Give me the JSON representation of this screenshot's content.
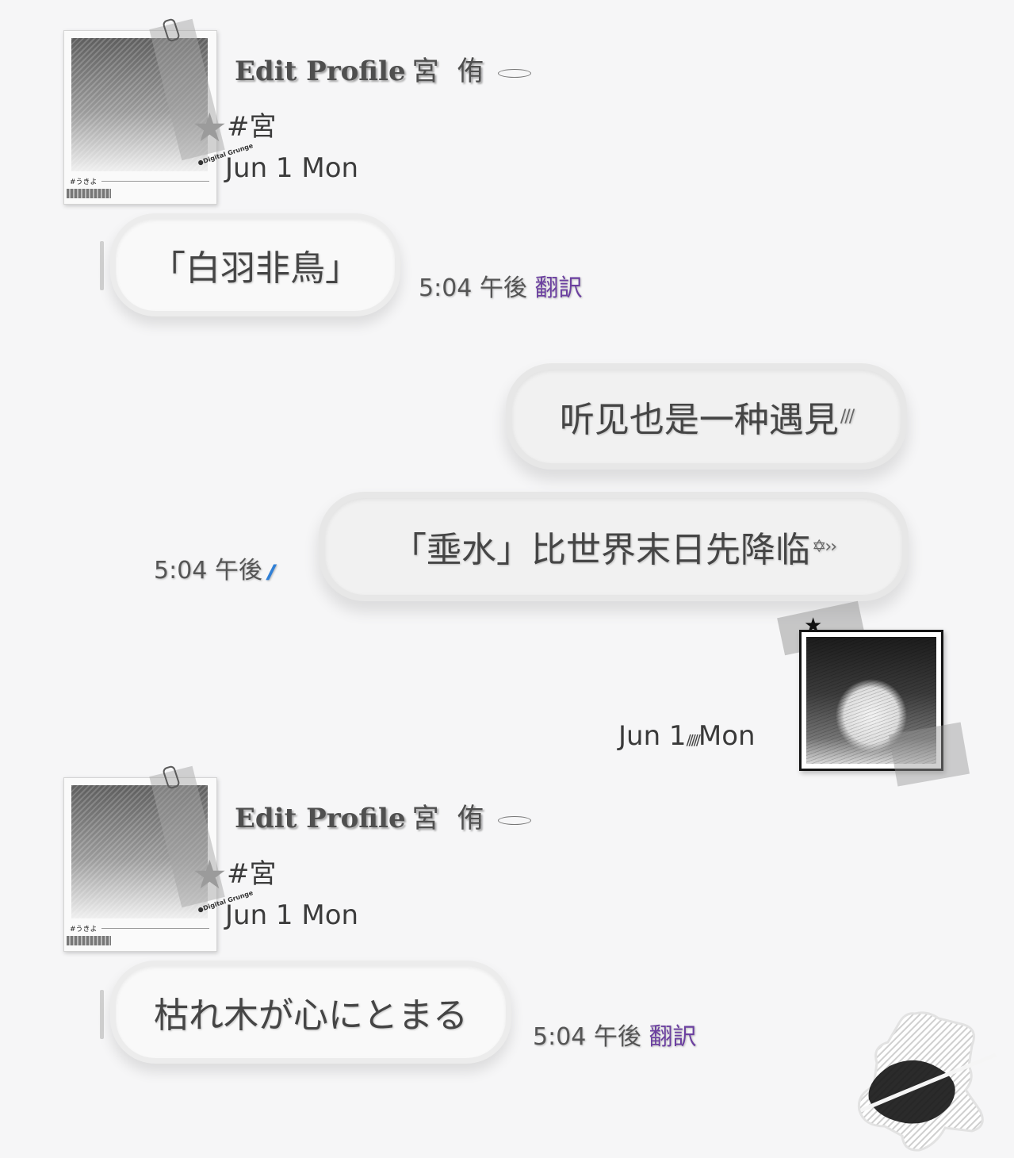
{
  "messages_top": {
    "profile": {
      "display_name": "Edit Profile",
      "name_kanji": "宮 侑",
      "tag": "#宮",
      "date": "Jun 1 Mon",
      "card_hash": "#うきよ",
      "card_grunge": "●Digital Grunge"
    },
    "incoming_1": {
      "text": "「白羽非鳥」",
      "time": "5:04 午後",
      "translate": "翻訳"
    }
  },
  "outgoing": {
    "msg_1": {
      "text": "听见也是一种遇見",
      "deco": "///"
    },
    "msg_2": {
      "text": "「埀水」比世界末日先降临",
      "deco": "✡››",
      "time": "5:04 午後",
      "read_mark": "//"
    },
    "avatar_date": {
      "left": "Jun 1",
      "slashes": "/////",
      "right": "Mon"
    }
  },
  "messages_bottom": {
    "profile": {
      "display_name": "Edit Profile",
      "name_kanji": "宮 侑",
      "tag": "#宮",
      "date": "Jun 1 Mon",
      "card_hash": "#うきよ",
      "card_grunge": "●Digital Grunge"
    },
    "incoming_2": {
      "text": "枯れ木が心にとまる",
      "time": "5:04 午後",
      "translate": "翻訳"
    }
  },
  "colors": {
    "translate": "#6b3fa0",
    "read_check": "#2f7fd6",
    "background": "#f6f6f7"
  }
}
